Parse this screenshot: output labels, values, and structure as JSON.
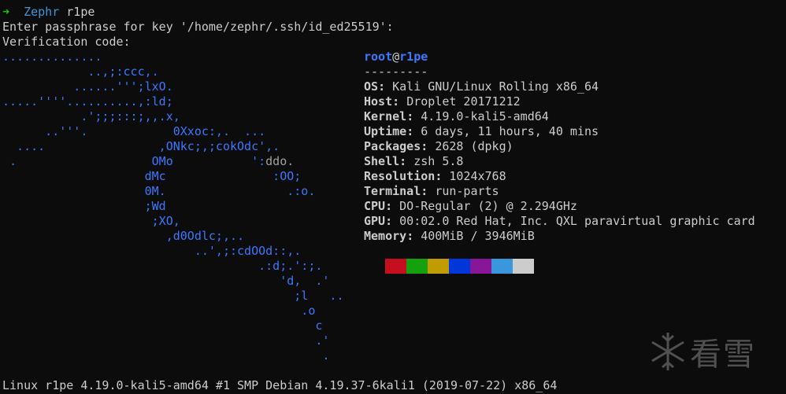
{
  "prompt": {
    "arrow": "➜",
    "dir": "Zephr",
    "command": "r1pe"
  },
  "ssh": {
    "passphrase_prompt": "Enter passphrase for key '/home/zephr/.ssh/id_ed25519':",
    "verification_prompt": "Verification code:"
  },
  "logo_art": [
    "..............",
    "            ..,;:ccc,.",
    "          ......''';lxO.",
    ".....''''..........,:ld;",
    "           .';;;:::;,,.x,",
    "      ..'''.            0Xxoc:,.  ...",
    "  ....                ,ONkc;,;cokOdc',.",
    " .                   OMo           ':ddo.",
    "                    dMc               :OO;",
    "                    0M.                 .:o.",
    "                    ;Wd",
    "                     ;XO,",
    "                       ,d0Odlc;,..",
    "                           ..',;:cdOOd::,.",
    "                                    .:d;.':;.",
    "                                       'd,  .'",
    "                                         ;l   ..",
    "                                          .o",
    "                                            c",
    "                                            .'",
    "                                             ."
  ],
  "header": {
    "user": "root",
    "at": "@",
    "host": "r1pe",
    "separator": "---------"
  },
  "info": [
    {
      "key": "OS",
      "value": "Kali GNU/Linux Rolling x86_64"
    },
    {
      "key": "Host",
      "value": "Droplet 20171212"
    },
    {
      "key": "Kernel",
      "value": "4.19.0-kali5-amd64"
    },
    {
      "key": "Uptime",
      "value": "6 days, 11 hours, 40 mins"
    },
    {
      "key": "Packages",
      "value": "2628 (dpkg)"
    },
    {
      "key": "Shell",
      "value": "zsh 5.8"
    },
    {
      "key": "Resolution",
      "value": "1024x768"
    },
    {
      "key": "Terminal",
      "value": "run-parts"
    },
    {
      "key": "CPU",
      "value": "DO-Regular (2) @ 2.294GHz"
    },
    {
      "key": "GPU",
      "value": "00:02.0 Red Hat, Inc. QXL paravirtual graphic card"
    },
    {
      "key": "Memory",
      "value": "400MiB / 3946MiB"
    }
  ],
  "color_swatches": [
    "#c50f1f",
    "#13a10e",
    "#c19c00",
    "#0037da",
    "#881798",
    "#3a96dd",
    "#cccccc"
  ],
  "uname_line": "Linux r1pe 4.19.0-kali5-amd64 #1 SMP Debian 4.19.37-6kali1 (2019-07-22) x86_64",
  "watermark": {
    "text": "看雪"
  }
}
